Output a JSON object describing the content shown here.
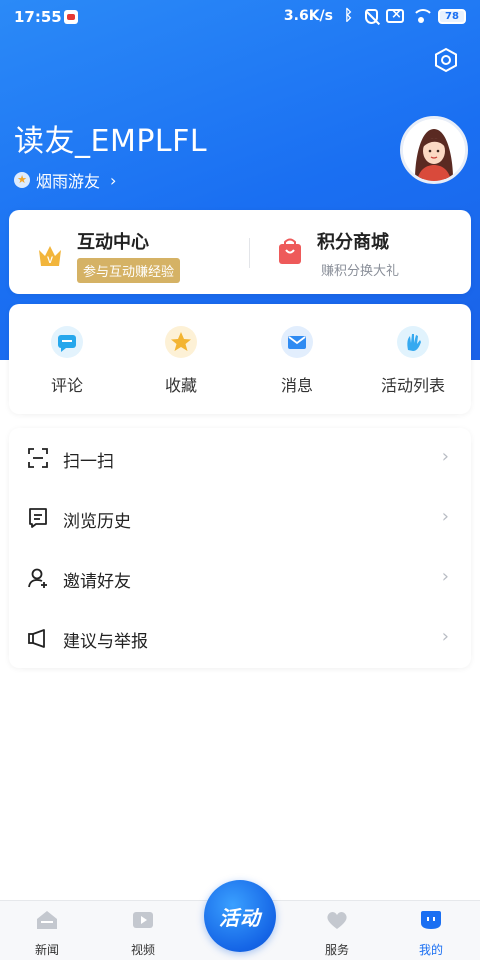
{
  "status_bar": {
    "time": "17:55",
    "speed": "3.6K/s",
    "battery": "78"
  },
  "profile": {
    "username": "读友_EMPLFL",
    "level_star": "★",
    "level": "烟雨游友",
    "level_chevron": "›"
  },
  "promo": {
    "interaction_title": "互动中心",
    "interaction_badge": "参与互动赚经验",
    "shop_title": "积分商城",
    "shop_subtitle": "赚积分换大礼"
  },
  "quick_actions": [
    {
      "label": "评论",
      "icon": "comment-icon",
      "color": "#26a7ec"
    },
    {
      "label": "收藏",
      "icon": "favorite-star-icon",
      "color": "#f3b431"
    },
    {
      "label": "消息",
      "icon": "message-envelope-icon",
      "color": "#2f8bf2"
    },
    {
      "label": "活动列表",
      "icon": "activity-hand-icon",
      "color": "#35a9f0"
    }
  ],
  "menu": [
    {
      "label": "扫一扫",
      "icon": "scan-icon"
    },
    {
      "label": "浏览历史",
      "icon": "history-icon"
    },
    {
      "label": "邀请好友",
      "icon": "invite-friend-icon"
    },
    {
      "label": "建议与举报",
      "icon": "feedback-icon"
    }
  ],
  "menu_chevron": "›",
  "tabbar": {
    "news": "新闻",
    "video": "视频",
    "activity": "活动",
    "service": "服务",
    "mine": "我的"
  },
  "colors": {
    "brand_blue": "#1a6ff2",
    "gold_badge": "#d5b265",
    "shop_red": "#ee5a5a"
  }
}
